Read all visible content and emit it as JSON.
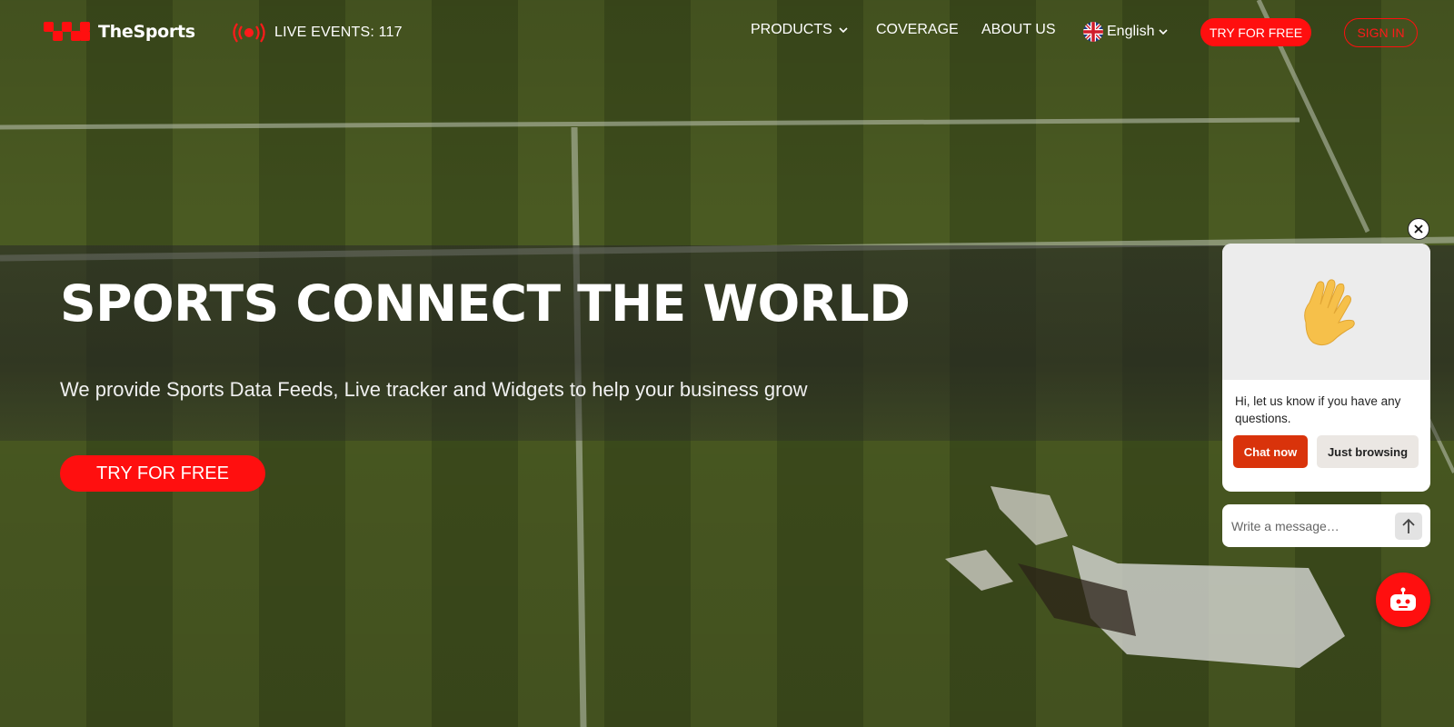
{
  "brand": {
    "name": "TheSports",
    "accent_color": "#ff0f0f",
    "logo_icon": "checker-logo-icon"
  },
  "live": {
    "icon": "live-broadcast-icon",
    "label": "LIVE EVENTS: 117"
  },
  "nav": {
    "products": "PRODUCTS",
    "coverage": "COVERAGE",
    "about": "ABOUT US",
    "language": "English",
    "language_icon": "uk-flag-icon",
    "try_free": "TRY FOR FREE",
    "sign_in": "SIGN IN"
  },
  "hero": {
    "title": "SPORTS CONNECT THE WORLD",
    "subtitle": "We provide Sports Data Feeds, Live tracker and Widgets to help your business grow",
    "cta": "TRY FOR FREE"
  },
  "chat": {
    "greeting_icon": "waving-hand-icon",
    "message": "Hi, let us know if you have any questions.",
    "chat_now": "Chat now",
    "just_browsing": "Just browsing",
    "input_placeholder": "Write a message…",
    "chat_now_color": "#d9330b"
  }
}
